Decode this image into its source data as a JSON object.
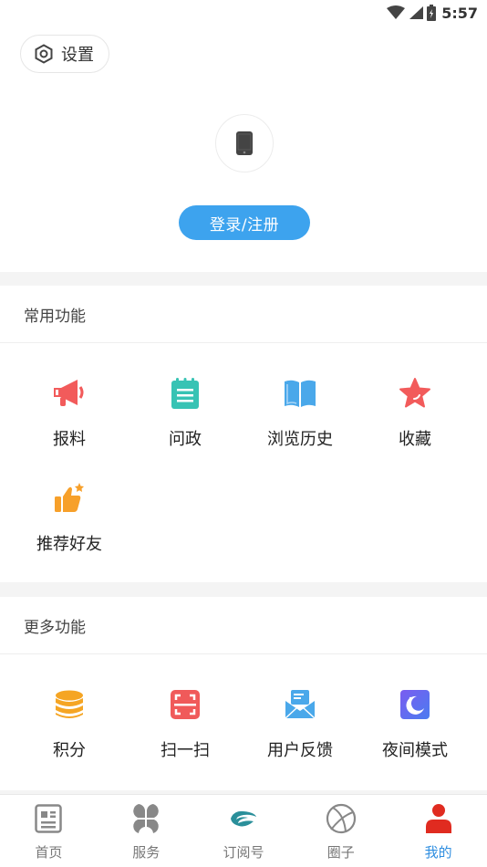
{
  "status_bar": {
    "time": "5:57"
  },
  "header": {
    "settings_label": "设置",
    "login_label": "登录/注册"
  },
  "common": {
    "title": "常用功能",
    "items": [
      {
        "label": "报料",
        "icon": "megaphone-icon"
      },
      {
        "label": "问政",
        "icon": "notepad-icon"
      },
      {
        "label": "浏览历史",
        "icon": "book-icon"
      },
      {
        "label": "收藏",
        "icon": "star-icon"
      },
      {
        "label": "推荐好友",
        "icon": "thumbs-up-icon"
      }
    ]
  },
  "more": {
    "title": "更多功能",
    "items": [
      {
        "label": "积分",
        "icon": "coins-icon"
      },
      {
        "label": "扫一扫",
        "icon": "scan-icon"
      },
      {
        "label": "用户反馈",
        "icon": "envelope-icon"
      },
      {
        "label": "夜间模式",
        "icon": "moon-icon"
      }
    ]
  },
  "tabbar": {
    "tabs": [
      {
        "label": "首页",
        "icon": "news-icon"
      },
      {
        "label": "服务",
        "icon": "grid-icon"
      },
      {
        "label": "订阅号",
        "icon": "subscribe-icon"
      },
      {
        "label": "圈子",
        "icon": "circle-icon"
      },
      {
        "label": "我的",
        "icon": "person-icon",
        "active": true
      }
    ]
  },
  "colors": {
    "accent": "#3da3ee",
    "tab_active": "#2f8ee0",
    "person_red": "#e02b20"
  }
}
